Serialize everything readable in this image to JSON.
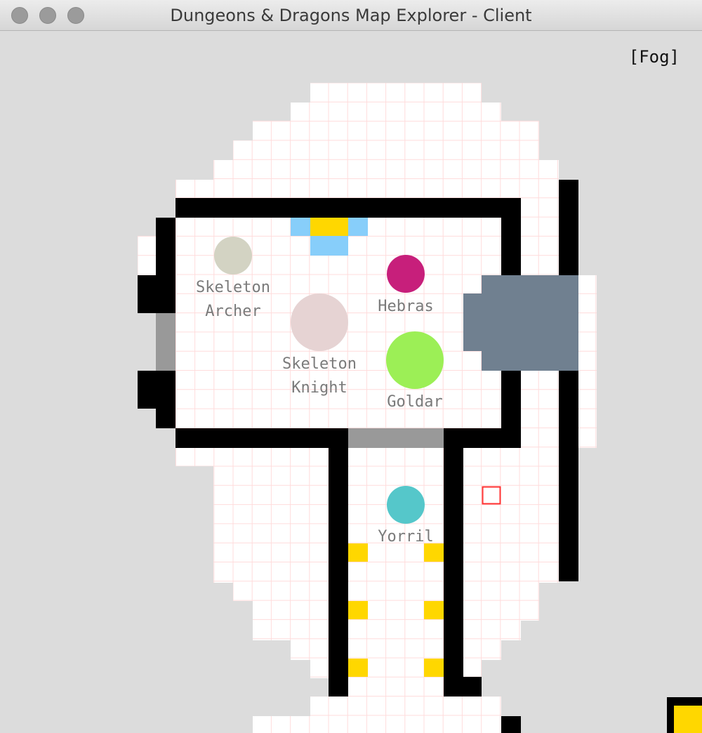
{
  "window": {
    "title": "Dungeons & Dragons Map Explorer - Client"
  },
  "overlay": {
    "fog_label": "[Fog]"
  },
  "colors": {
    "background": "#dcdcdc",
    "floor": "#ffffff",
    "grid": "#ffdcdc",
    "wall": "#000000",
    "door": "#999999",
    "water": "#87cefa",
    "gold": "#ffd700",
    "statue": "#708090",
    "cursor": "#ff3030"
  },
  "tokens": [
    {
      "id": "skeleton-archer",
      "label_lines": [
        "Skeleton",
        "Archer"
      ],
      "color": "#d3d3c3"
    },
    {
      "id": "hebras",
      "label_lines": [
        "Hebras"
      ],
      "color": "#c71f7b"
    },
    {
      "id": "skeleton-knight",
      "label_lines": [
        "Skeleton",
        "Knight"
      ],
      "color": "#e6d3d3"
    },
    {
      "id": "goldar",
      "label_lines": [
        "Goldar"
      ],
      "color": "#9cef56"
    },
    {
      "id": "yorril",
      "label_lines": [
        "Yorril"
      ],
      "color": "#55c7ca"
    }
  ]
}
